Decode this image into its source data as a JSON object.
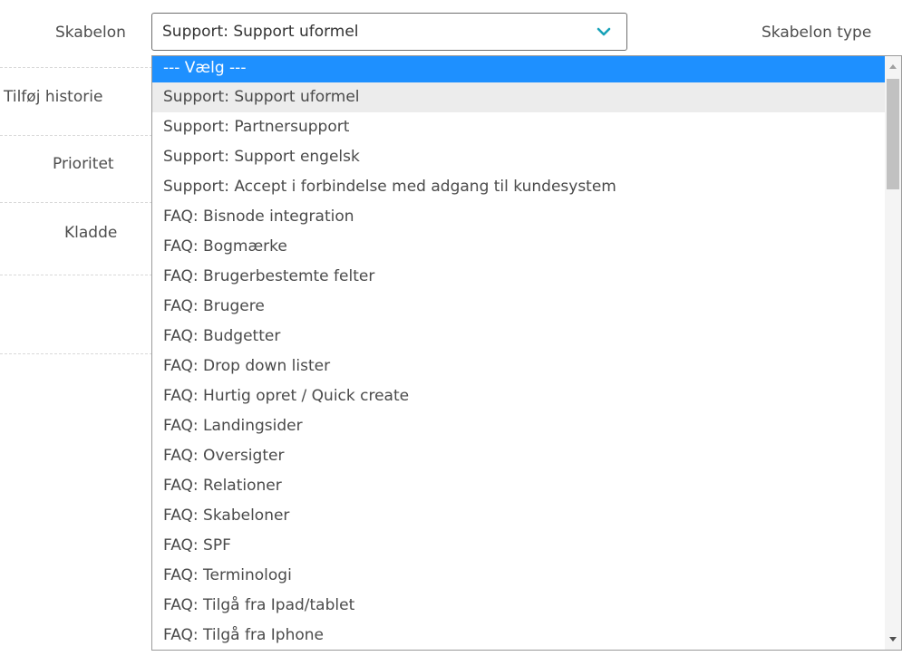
{
  "form": {
    "skabelon_label": "Skabelon",
    "skabelon_type_label": "Skabelon type",
    "tilfoj_historie_label": "Tilføj historie",
    "prioritet_label": "Prioritet",
    "kladde_label": "Kladde"
  },
  "select": {
    "value": "Support: Support uformel",
    "icon": "chevron-down-icon",
    "accent_color": "#17a2b8"
  },
  "dropdown": {
    "highlight_color": "#1e90ff",
    "options": [
      "--- Vælg ---",
      "Support: Support uformel",
      "Support: Partnersupport",
      "Support: Support engelsk",
      "Support: Accept i forbindelse med adgang til kundesystem",
      "FAQ: Bisnode integration",
      "FAQ: Bogmærke",
      "FAQ: Brugerbestemte felter",
      "FAQ: Brugere",
      "FAQ: Budgetter",
      "FAQ: Drop down lister",
      "FAQ: Hurtig opret / Quick create",
      "FAQ: Landingsider",
      "FAQ: Oversigter",
      "FAQ: Relationer",
      "FAQ: Skabeloner",
      "FAQ: SPF",
      "FAQ: Terminologi",
      "FAQ: Tilgå fra Ipad/tablet",
      "FAQ: Tilgå fra Iphone"
    ]
  }
}
